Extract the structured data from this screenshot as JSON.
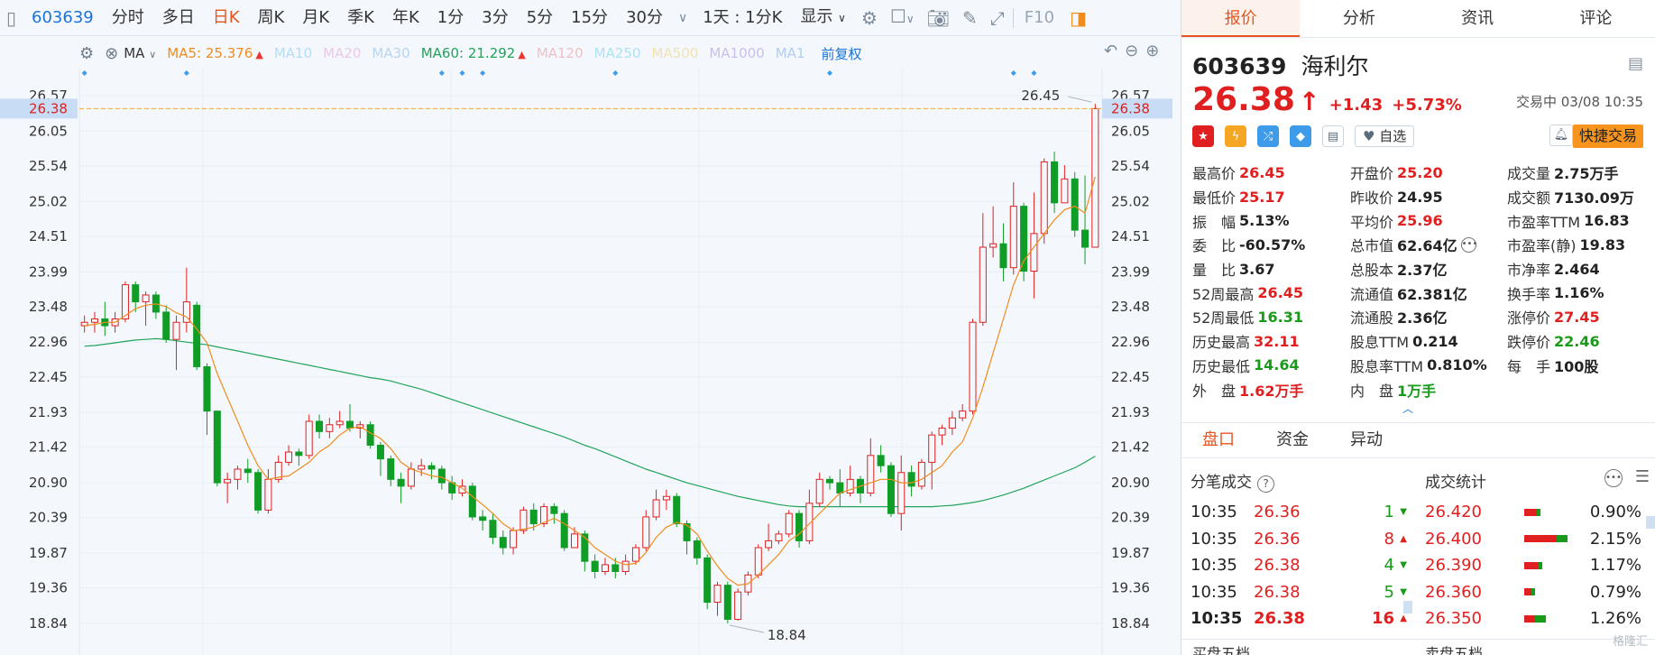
{
  "toolbar": {
    "code": "603639",
    "tabs": [
      {
        "label": "分时",
        "active": false
      },
      {
        "label": "多日",
        "active": false
      },
      {
        "label": "日K",
        "active": true
      },
      {
        "label": "周K",
        "active": false
      },
      {
        "label": "月K",
        "active": false
      },
      {
        "label": "季K",
        "active": false
      },
      {
        "label": "年K",
        "active": false
      },
      {
        "label": "1分",
        "active": false
      },
      {
        "label": "3分",
        "active": false
      },
      {
        "label": "5分",
        "active": false
      },
      {
        "label": "15分",
        "active": false
      },
      {
        "label": "30分",
        "active": false
      }
    ],
    "period_select": "1天 : 1分K",
    "display_label": "显示",
    "f10_label": "F10"
  },
  "ma": {
    "selector": "MA",
    "restore_label": "前复权",
    "items": [
      {
        "name": "MA5",
        "value": "25.376",
        "color": "#f08c1e",
        "shown": true,
        "arrow": true
      },
      {
        "name": "MA10",
        "value": "",
        "color": "#3fa9e6",
        "shown": false,
        "arrow": false
      },
      {
        "name": "MA20",
        "value": "",
        "color": "#d86bc0",
        "shown": false,
        "arrow": false
      },
      {
        "name": "MA30",
        "value": "",
        "color": "#4a8fd6",
        "shown": false,
        "arrow": false
      },
      {
        "name": "MA60",
        "value": "21.292",
        "color": "#22a35a",
        "shown": true,
        "arrow": true
      },
      {
        "name": "MA120",
        "value": "",
        "color": "#e35a5a",
        "shown": false,
        "arrow": false
      },
      {
        "name": "MA250",
        "value": "",
        "color": "#29b6e8",
        "shown": false,
        "arrow": false
      },
      {
        "name": "MA500",
        "value": "",
        "color": "#e8b92a",
        "shown": false,
        "arrow": false
      },
      {
        "name": "MA1000",
        "value": "",
        "color": "#7a55c9",
        "shown": false,
        "arrow": false
      },
      {
        "name": "MA1",
        "value": "",
        "color": "#3a7bd5",
        "shown": false,
        "arrow": false
      }
    ]
  },
  "chart_data": {
    "type": "candlestick",
    "y_ticks": [
      "26.57",
      "26.05",
      "25.54",
      "25.02",
      "24.51",
      "23.99",
      "23.48",
      "22.96",
      "22.45",
      "21.93",
      "21.42",
      "20.90",
      "20.39",
      "19.87",
      "19.36",
      "18.84"
    ],
    "ylim": [
      18.84,
      26.57
    ],
    "current_price": "26.38",
    "high_label": "26.45",
    "low_label": "18.84",
    "colors": {
      "up": "#e02020",
      "down": "#0f9d26",
      "ma5": "#f08c1e",
      "ma60": "#22a35a",
      "price_line": "#f3a531"
    },
    "candles": [
      [
        23.2,
        23.25,
        23.35,
        23.1
      ],
      [
        23.25,
        23.3,
        23.4,
        23.1
      ],
      [
        23.3,
        23.2,
        23.55,
        23.05
      ],
      [
        23.2,
        23.3,
        23.4,
        23.1
      ],
      [
        23.3,
        23.8,
        23.85,
        23.25
      ],
      [
        23.8,
        23.55,
        23.85,
        23.4
      ],
      [
        23.55,
        23.65,
        23.7,
        23.2
      ],
      [
        23.65,
        23.4,
        23.7,
        23.3
      ],
      [
        23.4,
        23.0,
        23.5,
        22.95
      ],
      [
        23.0,
        23.25,
        23.35,
        22.55
      ],
      [
        23.25,
        23.55,
        24.05,
        23.1
      ],
      [
        23.5,
        22.6,
        23.55,
        22.55
      ],
      [
        22.6,
        21.95,
        22.65,
        21.6
      ],
      [
        21.95,
        20.9,
        21.95,
        20.85
      ],
      [
        20.9,
        20.95,
        21.05,
        20.6
      ],
      [
        20.95,
        21.1,
        21.15,
        20.8
      ],
      [
        21.1,
        21.05,
        21.25,
        20.9
      ],
      [
        21.05,
        20.5,
        21.1,
        20.45
      ],
      [
        20.5,
        20.95,
        21.1,
        20.45
      ],
      [
        20.95,
        21.2,
        21.3,
        20.9
      ],
      [
        21.2,
        21.35,
        21.45,
        21.15
      ],
      [
        21.35,
        21.3,
        21.4,
        21.15
      ],
      [
        21.3,
        21.8,
        21.9,
        21.25
      ],
      [
        21.8,
        21.65,
        21.9,
        21.55
      ],
      [
        21.65,
        21.75,
        21.85,
        21.55
      ],
      [
        21.75,
        21.8,
        21.95,
        21.7
      ],
      [
        21.8,
        21.7,
        22.05,
        21.65
      ],
      [
        21.7,
        21.75,
        21.8,
        21.55
      ],
      [
        21.75,
        21.45,
        21.8,
        21.4
      ],
      [
        21.45,
        21.25,
        21.5,
        21.0
      ],
      [
        21.25,
        20.95,
        21.3,
        20.85
      ],
      [
        20.95,
        20.85,
        21.05,
        20.6
      ],
      [
        20.85,
        21.1,
        21.2,
        20.8
      ],
      [
        21.1,
        21.15,
        21.25,
        21.0
      ],
      [
        21.15,
        21.1,
        21.2,
        20.95
      ],
      [
        21.1,
        20.9,
        21.15,
        20.8
      ],
      [
        20.9,
        20.75,
        21.0,
        20.65
      ],
      [
        20.75,
        20.85,
        20.95,
        20.7
      ],
      [
        20.85,
        20.4,
        20.9,
        20.35
      ],
      [
        20.4,
        20.35,
        20.5,
        20.2
      ],
      [
        20.35,
        20.1,
        20.45,
        20.0
      ],
      [
        20.1,
        19.95,
        20.2,
        19.85
      ],
      [
        19.95,
        20.2,
        20.25,
        19.85
      ],
      [
        20.2,
        20.5,
        20.55,
        20.15
      ],
      [
        20.5,
        20.3,
        20.6,
        20.2
      ],
      [
        20.3,
        20.55,
        20.6,
        20.25
      ],
      [
        20.55,
        20.45,
        20.6,
        20.3
      ],
      [
        20.45,
        19.95,
        20.5,
        19.9
      ],
      [
        19.95,
        20.15,
        20.25,
        19.95
      ],
      [
        20.15,
        19.75,
        20.2,
        19.6
      ],
      [
        19.75,
        19.6,
        19.85,
        19.5
      ],
      [
        19.6,
        19.7,
        19.8,
        19.55
      ],
      [
        19.7,
        19.6,
        19.8,
        19.5
      ],
      [
        19.6,
        19.75,
        19.85,
        19.55
      ],
      [
        19.75,
        19.95,
        20.0,
        19.7
      ],
      [
        19.95,
        20.4,
        20.5,
        19.9
      ],
      [
        20.4,
        20.65,
        20.8,
        20.35
      ],
      [
        20.65,
        20.7,
        20.8,
        20.5
      ],
      [
        20.7,
        20.3,
        20.75,
        20.25
      ],
      [
        20.3,
        20.05,
        20.35,
        19.85
      ],
      [
        20.05,
        19.8,
        20.1,
        19.7
      ],
      [
        19.8,
        19.15,
        19.85,
        19.05
      ],
      [
        19.15,
        19.4,
        19.45,
        18.95
      ],
      [
        19.4,
        18.9,
        19.45,
        18.84
      ],
      [
        18.9,
        19.3,
        19.35,
        18.88
      ],
      [
        19.3,
        19.55,
        19.6,
        19.25
      ],
      [
        19.55,
        19.95,
        20.0,
        19.5
      ],
      [
        19.95,
        20.05,
        20.3,
        19.9
      ],
      [
        20.05,
        20.15,
        20.2,
        20.0
      ],
      [
        20.15,
        20.45,
        20.5,
        20.1
      ],
      [
        20.45,
        20.05,
        20.5,
        19.95
      ],
      [
        20.05,
        20.6,
        20.8,
        20.0
      ],
      [
        20.6,
        20.95,
        21.05,
        20.55
      ],
      [
        20.95,
        20.9,
        21.0,
        20.8
      ],
      [
        20.9,
        20.75,
        21.1,
        20.55
      ],
      [
        20.75,
        20.95,
        21.15,
        20.7
      ],
      [
        20.95,
        20.75,
        21.0,
        20.6
      ],
      [
        20.75,
        21.3,
        21.55,
        20.7
      ],
      [
        21.3,
        21.15,
        21.45,
        21.05
      ],
      [
        21.15,
        20.45,
        21.2,
        20.4
      ],
      [
        20.45,
        21.05,
        21.3,
        20.2
      ],
      [
        21.05,
        20.85,
        21.15,
        20.7
      ],
      [
        20.85,
        21.2,
        21.25,
        20.8
      ],
      [
        21.2,
        21.6,
        21.65,
        20.8
      ],
      [
        21.6,
        21.7,
        21.75,
        21.45
      ],
      [
        21.7,
        21.85,
        21.95,
        21.6
      ],
      [
        21.85,
        21.95,
        22.05,
        21.8
      ],
      [
        21.95,
        23.25,
        23.3,
        21.9
      ],
      [
        23.25,
        24.35,
        24.85,
        23.2
      ],
      [
        24.35,
        24.4,
        24.95,
        24.2
      ],
      [
        24.4,
        24.05,
        24.7,
        23.85
      ],
      [
        24.05,
        24.95,
        25.3,
        23.95
      ],
      [
        24.95,
        24.0,
        25.0,
        23.85
      ],
      [
        24.0,
        24.55,
        25.15,
        23.6
      ],
      [
        24.55,
        25.6,
        25.65,
        24.4
      ],
      [
        25.6,
        25.0,
        25.75,
        24.85
      ],
      [
        25.0,
        25.35,
        25.55,
        25.0
      ],
      [
        25.35,
        24.6,
        25.45,
        24.5
      ],
      [
        24.6,
        24.35,
        25.4,
        24.1
      ],
      [
        24.35,
        26.38,
        26.45,
        25.17
      ]
    ],
    "ma5": [
      23.2,
      23.22,
      23.25,
      23.25,
      23.35,
      23.45,
      23.5,
      23.52,
      23.48,
      23.39,
      23.33,
      23.15,
      22.95,
      22.5,
      22.15,
      21.8,
      21.45,
      21.15,
      20.95,
      20.98,
      21.0,
      21.1,
      21.2,
      21.35,
      21.45,
      21.6,
      21.7,
      21.72,
      21.63,
      21.55,
      21.4,
      21.2,
      21.1,
      21.05,
      21.0,
      20.98,
      20.9,
      20.82,
      20.7,
      20.58,
      20.45,
      20.3,
      20.2,
      20.22,
      20.25,
      20.32,
      20.38,
      20.3,
      20.2,
      20.1,
      19.95,
      19.85,
      19.75,
      19.7,
      19.72,
      19.88,
      20.1,
      20.25,
      20.32,
      20.28,
      20.15,
      19.9,
      19.68,
      19.5,
      19.4,
      19.42,
      19.55,
      19.7,
      19.85,
      20.05,
      20.15,
      20.3,
      20.45,
      20.6,
      20.75,
      20.8,
      20.85,
      20.9,
      20.95,
      20.95,
      20.9,
      20.9,
      20.95,
      21.05,
      21.15,
      21.35,
      21.5,
      21.85,
      22.3,
      22.8,
      23.3,
      23.8,
      24.15,
      24.35,
      24.55,
      24.75,
      24.9,
      24.95,
      24.85,
      25.38
    ],
    "ma60": [
      22.9,
      22.91,
      22.93,
      22.95,
      22.97,
      22.99,
      23.0,
      23.01,
      23.0,
      22.98,
      22.96,
      22.94,
      22.92,
      22.89,
      22.86,
      22.83,
      22.8,
      22.77,
      22.74,
      22.71,
      22.68,
      22.65,
      22.62,
      22.59,
      22.56,
      22.53,
      22.5,
      22.47,
      22.44,
      22.42,
      22.39,
      22.35,
      22.31,
      22.27,
      22.22,
      22.17,
      22.12,
      22.07,
      22.02,
      21.97,
      21.92,
      21.87,
      21.82,
      21.77,
      21.72,
      21.67,
      21.62,
      21.57,
      21.51,
      21.45,
      21.4,
      21.34,
      21.28,
      21.22,
      21.16,
      21.1,
      21.05,
      21.0,
      20.95,
      20.9,
      20.86,
      20.82,
      20.78,
      20.74,
      20.7,
      20.67,
      20.64,
      20.61,
      20.58,
      20.56,
      20.55,
      20.55,
      20.55,
      20.55,
      20.55,
      20.55,
      20.55,
      20.55,
      20.55,
      20.55,
      20.55,
      20.55,
      20.55,
      20.55,
      20.56,
      20.57,
      20.59,
      20.61,
      20.64,
      20.68,
      20.72,
      20.77,
      20.82,
      20.88,
      20.94,
      21.0,
      21.06,
      21.12,
      21.2,
      21.29
    ]
  },
  "stock": {
    "code": "603639",
    "name": "海利尔",
    "price": "26.38",
    "arrow": "↑",
    "change": "+1.43",
    "change_pct": "+5.73%",
    "status": "交易中 03/08 10:35",
    "watch_label": "自选",
    "fast_trade_label": "快捷交易"
  },
  "quote": [
    [
      {
        "label": "最高价",
        "value": "26.45",
        "color": "red"
      },
      {
        "label": "开盘价",
        "value": "25.20",
        "color": "red"
      },
      {
        "label": "成交量",
        "value": "2.75万手",
        "color": "blk"
      }
    ],
    [
      {
        "label": "最低价",
        "value": "25.17",
        "color": "red"
      },
      {
        "label": "昨收价",
        "value": "24.95",
        "color": "blk"
      },
      {
        "label": "成交额",
        "value": "7130.09万",
        "color": "blk"
      }
    ],
    [
      {
        "label": "振　幅",
        "value": "5.13%",
        "color": "blk"
      },
      {
        "label": "平均价",
        "value": "25.96",
        "color": "red"
      },
      {
        "label": "市盈率TTM",
        "value": "16.83",
        "color": "blk"
      }
    ],
    [
      {
        "label": "委　比",
        "value": "-60.57%",
        "color": "blk"
      },
      {
        "label": "总市值",
        "value": "62.64亿",
        "color": "blk",
        "more": true
      },
      {
        "label": "市盈率(静)",
        "value": "19.83",
        "color": "blk"
      }
    ],
    [
      {
        "label": "量　比",
        "value": "3.67",
        "color": "blk"
      },
      {
        "label": "总股本",
        "value": "2.37亿",
        "color": "blk"
      },
      {
        "label": "市净率",
        "value": "2.464",
        "color": "blk"
      }
    ],
    [
      {
        "label": "52周最高",
        "value": "26.45",
        "color": "red"
      },
      {
        "label": "流通值",
        "value": "62.381亿",
        "color": "blk"
      },
      {
        "label": "换手率",
        "value": "1.16%",
        "color": "blk"
      }
    ],
    [
      {
        "label": "52周最低",
        "value": "16.31",
        "color": "green"
      },
      {
        "label": "流通股",
        "value": "2.36亿",
        "color": "blk"
      },
      {
        "label": "涨停价",
        "value": "27.45",
        "color": "red"
      }
    ],
    [
      {
        "label": "历史最高",
        "value": "32.11",
        "color": "red"
      },
      {
        "label": "股息TTM",
        "value": "0.214",
        "color": "blk"
      },
      {
        "label": "跌停价",
        "value": "22.46",
        "color": "green"
      }
    ],
    [
      {
        "label": "历史最低",
        "value": "14.64",
        "color": "green"
      },
      {
        "label": "股息率TTM",
        "value": "0.810%",
        "color": "blk"
      },
      {
        "label": "每　手",
        "value": "100股",
        "color": "blk"
      }
    ],
    [
      {
        "label": "外　盘",
        "value": "1.62万手",
        "color": "red"
      },
      {
        "label": "内　盘",
        "value": "1万手",
        "color": "green"
      },
      null
    ]
  ],
  "panel_tabs": [
    {
      "label": "报价",
      "active": true
    },
    {
      "label": "分析",
      "active": false
    },
    {
      "label": "资讯",
      "active": false
    },
    {
      "label": "评论",
      "active": false
    }
  ],
  "sub_tabs": [
    {
      "label": "盘口",
      "active": true
    },
    {
      "label": "资金",
      "active": false
    },
    {
      "label": "异动",
      "active": false
    }
  ],
  "trades_title": "分笔成交",
  "stats_title": "成交统计",
  "trades": [
    {
      "time": "10:35",
      "price": "26.36",
      "vol": "1",
      "dir": "down",
      "bold": false
    },
    {
      "time": "10:35",
      "price": "26.36",
      "vol": "8",
      "dir": "up",
      "bold": false
    },
    {
      "time": "10:35",
      "price": "26.38",
      "vol": "4",
      "dir": "down",
      "bold": false
    },
    {
      "time": "10:35",
      "price": "26.38",
      "vol": "5",
      "dir": "down",
      "bold": false
    },
    {
      "time": "10:35",
      "price": "26.38",
      "vol": "16",
      "dir": "up",
      "bold": true
    }
  ],
  "stats": [
    {
      "price": "26.420",
      "pct": "0.90%",
      "red": 0.35,
      "green": 0.1
    },
    {
      "price": "26.400",
      "pct": "2.15%",
      "red": 0.9,
      "green": 0.3
    },
    {
      "price": "26.390",
      "pct": "1.17%",
      "red": 0.4,
      "green": 0.1
    },
    {
      "price": "26.360",
      "pct": "0.79%",
      "red": 0.2,
      "green": 0.1
    },
    {
      "price": "26.350",
      "pct": "1.26%",
      "red": 0.3,
      "green": 0.3
    }
  ],
  "bottom": {
    "buy5": "买盘五档",
    "sell5": "卖盘五档"
  },
  "watermark": "格隆汇"
}
